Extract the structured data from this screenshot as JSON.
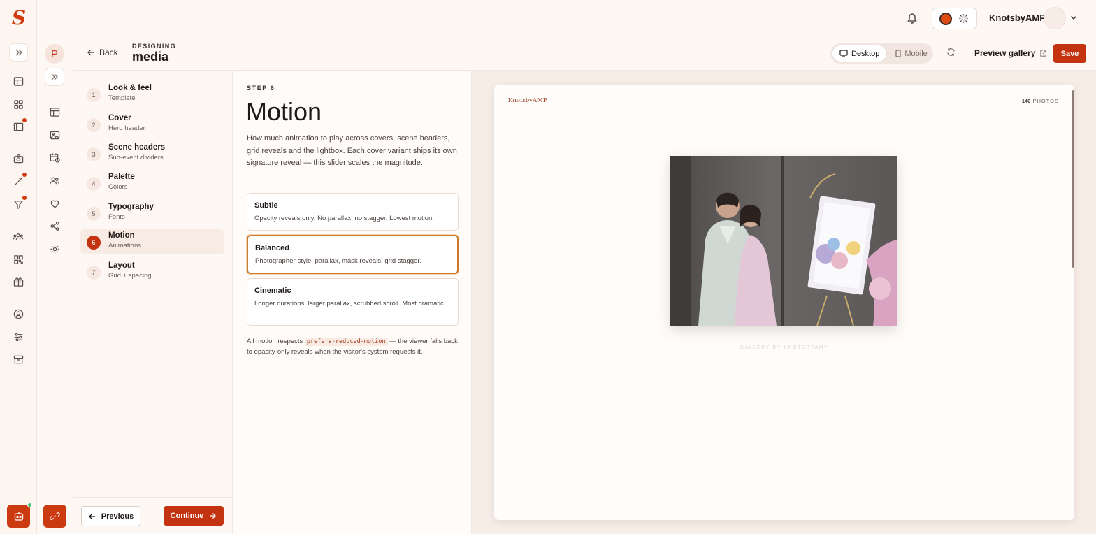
{
  "app": {
    "logo_glyph": "S",
    "accent_color": "#c4330f"
  },
  "topbar": {
    "username": "KnotsbyAMP"
  },
  "workspace": {
    "avatar_letter": "P"
  },
  "subbar": {
    "back_label": "Back",
    "eyebrow": "DESIGNING",
    "title": "media",
    "device_desktop": "Desktop",
    "device_mobile": "Mobile",
    "active_device": "Desktop",
    "preview_label": "Preview gallery",
    "save_label": "Save"
  },
  "steps": [
    {
      "num": "1",
      "title": "Look & feel",
      "sub": "Template"
    },
    {
      "num": "2",
      "title": "Cover",
      "sub": "Hero header"
    },
    {
      "num": "3",
      "title": "Scene headers",
      "sub": "Sub-event dividers"
    },
    {
      "num": "4",
      "title": "Palette",
      "sub": "Colors"
    },
    {
      "num": "5",
      "title": "Typography",
      "sub": "Fonts"
    },
    {
      "num": "6",
      "title": "Motion",
      "sub": "Animations"
    },
    {
      "num": "7",
      "title": "Layout",
      "sub": "Grid + spacing"
    }
  ],
  "active_step": 6,
  "nav": {
    "previous_label": "Previous",
    "continue_label": "Continue"
  },
  "main": {
    "step_label": "STEP 6",
    "title": "Motion",
    "description": "How much animation to play across covers, scene headers, grid reveals and the lightbox. Each cover variant ships its own signature reveal — this slider scales the magnitude.",
    "options": [
      {
        "title": "Subtle",
        "desc": "Opacity reveals only. No parallax, no stagger. Lowest motion."
      },
      {
        "title": "Balanced",
        "desc": "Photographer-style: parallax, mask reveals, grid stagger."
      },
      {
        "title": "Cinematic",
        "desc": "Longer durations, larger parallax, scrubbed scroll. Most dramatic."
      }
    ],
    "selected_option": "Balanced",
    "footnote_pre": "All motion respects",
    "footnote_code": "prefers-reduced-motion",
    "footnote_post": "— the viewer falls back to opacity-only reveals when the visitor's system requests it."
  },
  "preview": {
    "brand": "KnotsbyAMP",
    "photo_count": "140",
    "photo_label": "PHOTOS",
    "gallery_by": "GALLERY BY KNOTSBYAMP"
  }
}
